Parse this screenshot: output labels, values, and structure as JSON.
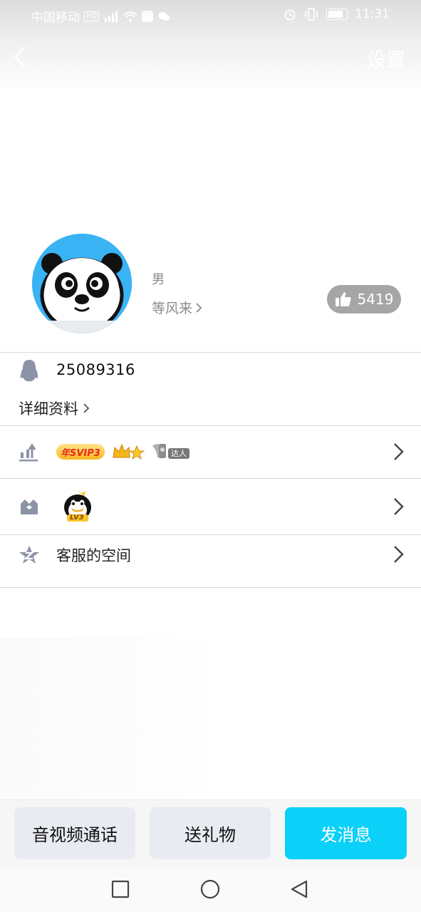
{
  "status_bar": {
    "carrier": "中国移动",
    "hd": "HD",
    "time": "11:31"
  },
  "header": {
    "settings_label": "设置"
  },
  "profile": {
    "gender": "男",
    "signature": "等风来",
    "likes": "5419",
    "qq_number": "25089316",
    "detail_label": "详细资料"
  },
  "rows": {
    "vip_badge": "年SVIP3",
    "achievement_badge": "达人",
    "level_badge": "LV3",
    "zone_label": "客服的空间"
  },
  "actions": {
    "call_label": "音视频通话",
    "gift_label": "送礼物",
    "message_label": "发消息"
  },
  "colors": {
    "accent": "#0bd0f7",
    "avatar_bg": "#3ab3f5",
    "icon_gray": "#8d93a7"
  }
}
